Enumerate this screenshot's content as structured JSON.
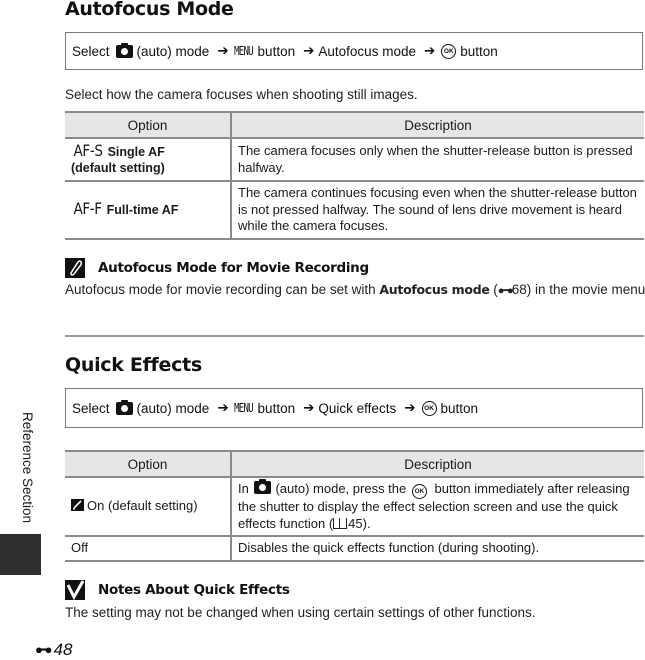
{
  "side_tab": {
    "label": "Reference Section"
  },
  "page": {
    "number_prefix_icon": "reference-binocular-icon",
    "number": "48"
  },
  "autofocus": {
    "title": "Autofocus Mode",
    "path": {
      "select": "Select",
      "mode_icon": "camera-auto-icon",
      "mode_label": "(auto) mode",
      "arrow": "➔",
      "menu_glyph": "MENU",
      "button_label": "button",
      "item": "Autofocus mode",
      "ok_icon": "OK",
      "ok_button_label": "button"
    },
    "lead": "Select how the camera focuses when shooting still images.",
    "table": {
      "headers": [
        "Option",
        "Description"
      ],
      "rows": [
        {
          "glyph": "AF-S",
          "option": "Single AF",
          "option_sub": "(default setting)",
          "description": "The camera focuses only when the shutter-release button is pressed halfway."
        },
        {
          "glyph": "AF-F",
          "option": "Full-time AF",
          "option_sub": "",
          "description": "The camera continues focusing even when the shutter-release button is not pressed halfway. The sound of lens drive movement is heard while the camera focuses."
        }
      ]
    },
    "note": {
      "icon": "pencil-note-icon",
      "title": "Autofocus Mode for Movie Recording",
      "text_before": "Autofocus mode for movie recording can be set with ",
      "text_bold": "Autofocus mode",
      "ref_open": " (",
      "ref_page": "68",
      "text_after": ") in the movie menu."
    }
  },
  "quick_effects": {
    "title": "Quick Effects",
    "path": {
      "select": "Select",
      "mode_icon": "camera-auto-icon",
      "mode_label": "(auto) mode",
      "arrow": "➔",
      "menu_glyph": "MENU",
      "button_label": "button",
      "item": "Quick effects",
      "ok_icon": "OK",
      "ok_button_label": "button"
    },
    "table": {
      "headers": [
        "Option",
        "Description"
      ],
      "rows": [
        {
          "option_icon": "quick-effects-icon",
          "option": "On (default setting)",
          "desc_in": "In ",
          "desc_mode": "(auto) mode, press the ",
          "desc_ok": "OK",
          "desc_rest": " button immediately after releasing the shutter to display the effect selection screen and use the quick effects function (",
          "desc_ref": "45",
          "desc_close": ")."
        },
        {
          "option": "Off",
          "description": "Disables the quick effects function (during shooting)."
        }
      ]
    },
    "note": {
      "icon": "checkmark-note-icon",
      "title": "Notes About Quick Effects",
      "text": "The setting may not be changed when using certain settings of other functions."
    }
  }
}
